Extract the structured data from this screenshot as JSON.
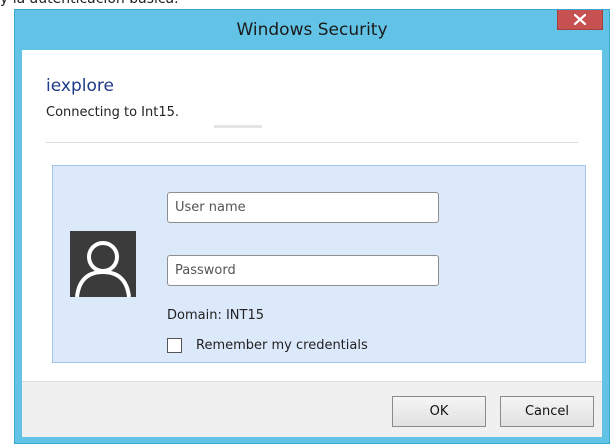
{
  "window": {
    "title": "Windows Security",
    "accent_color": "#62c3e6",
    "close_color": "#c75050"
  },
  "header": {
    "app_name": "iexplore",
    "message": "Connecting to Int15."
  },
  "credentials": {
    "username_placeholder": "User name",
    "username_value": "",
    "password_placeholder": "Password",
    "password_value": "",
    "domain_text": "Domain: INT15",
    "remember_label": "Remember my credentials",
    "remember_checked": false,
    "panel_color": "#dce9fb"
  },
  "buttons": {
    "ok_label": "OK",
    "cancel_label": "Cancel"
  },
  "icons": {
    "close": "close-icon",
    "avatar": "user-avatar-icon"
  }
}
